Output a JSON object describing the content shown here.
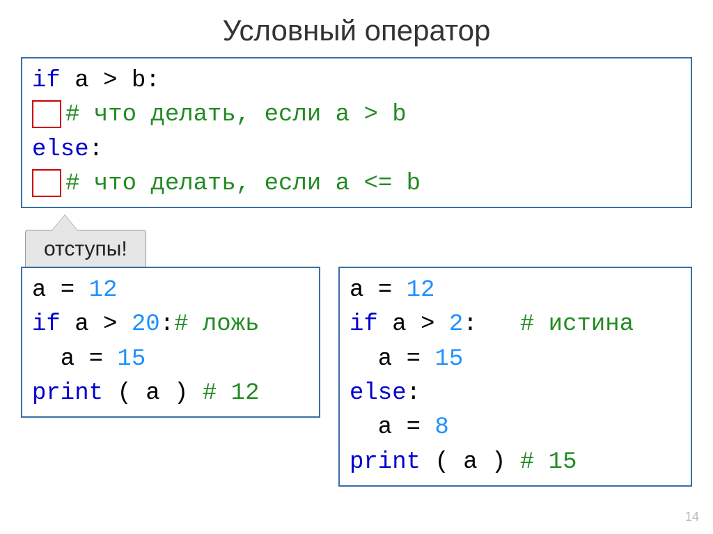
{
  "title": "Условный оператор",
  "callout": "отступы!",
  "page_num": "14",
  "top": {
    "l1_kw": "if",
    "l1_rest": " a > b:",
    "l2_cmt": "# что делать, если a > b",
    "l3_kw": "else",
    "l3_rest": ":",
    "l4_cmt": "# что делать, если a <= b"
  },
  "left": {
    "l1_a": "a = ",
    "l1_v": "12",
    "l2_kw": "if",
    "l2_mid": " a > ",
    "l2_v": "20",
    "l2_colon": ":",
    "l2_cmt": "# ложь",
    "l3_a": "  a = ",
    "l3_v": "15",
    "l4_kw": "print",
    "l4_rest": " ( a ) ",
    "l4_cmt": "# 12"
  },
  "right": {
    "l1_a": "a = ",
    "l1_v": "12",
    "l2_kw": "if",
    "l2_mid": " a > ",
    "l2_v": "2",
    "l2_colon": ":   ",
    "l2_cmt": "# истина",
    "l3_a": "  a = ",
    "l3_v": "15",
    "l4_kw": "else",
    "l4_rest": ":",
    "l5_a": "  a = ",
    "l5_v": "8",
    "l6_kw": "print",
    "l6_rest": " ( a ) ",
    "l6_cmt": "# 15"
  }
}
